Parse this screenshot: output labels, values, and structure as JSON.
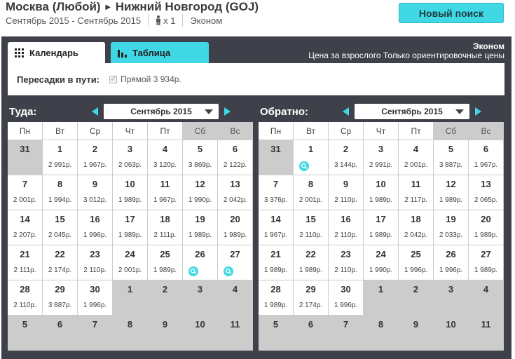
{
  "header": {
    "route_from": "Москва (Любой)",
    "route_to": "Нижний Новгород (GOJ)",
    "dates": "Сентябрь 2015 - Сентябрь 2015",
    "pax": "x 1",
    "cabin": "Эконом",
    "new_search_label": "Новый поиск"
  },
  "tabs": [
    {
      "label": "Календарь",
      "active": true
    },
    {
      "label": "Таблица",
      "active": false
    }
  ],
  "info": {
    "cabin": "Эконом",
    "note": "Цена за взрослого Только ориентировочные цены"
  },
  "filter": {
    "label": "Пересадки в пути:",
    "option": "Прямой 3 934р.",
    "checked": true
  },
  "colors": {
    "accent": "#3fd8e4",
    "panel": "#3e4149",
    "weekend": "#cccccc"
  },
  "weekdays": [
    "Пн",
    "Вт",
    "Ср",
    "Чт",
    "Пт",
    "Сб",
    "Вс"
  ],
  "outbound": {
    "title": "Туда:",
    "month": "Сентябрь 2015",
    "days": [
      {
        "d": "31",
        "p": "",
        "out": true
      },
      {
        "d": "1",
        "p": "2 991р."
      },
      {
        "d": "2",
        "p": "1 967р."
      },
      {
        "d": "3",
        "p": "2 063р."
      },
      {
        "d": "4",
        "p": "3 120р."
      },
      {
        "d": "5",
        "p": "3 869р."
      },
      {
        "d": "6",
        "p": "2 122р."
      },
      {
        "d": "7",
        "p": "2 001р."
      },
      {
        "d": "8",
        "p": "1 994р."
      },
      {
        "d": "9",
        "p": "3 012р."
      },
      {
        "d": "10",
        "p": "1 989р."
      },
      {
        "d": "11",
        "p": "1 967р."
      },
      {
        "d": "12",
        "p": "1 990р."
      },
      {
        "d": "13",
        "p": "2 042р."
      },
      {
        "d": "14",
        "p": "2 207р."
      },
      {
        "d": "15",
        "p": "2 045р."
      },
      {
        "d": "16",
        "p": "1 996р."
      },
      {
        "d": "17",
        "p": "1 989р."
      },
      {
        "d": "18",
        "p": "2 111р."
      },
      {
        "d": "19",
        "p": "1 989р."
      },
      {
        "d": "20",
        "p": "1 989р."
      },
      {
        "d": "21",
        "p": "2 111р."
      },
      {
        "d": "22",
        "p": "2 174р."
      },
      {
        "d": "23",
        "p": "2 110р."
      },
      {
        "d": "24",
        "p": "2 001р."
      },
      {
        "d": "25",
        "p": "1 989р."
      },
      {
        "d": "26",
        "p": "",
        "search": true
      },
      {
        "d": "27",
        "p": "",
        "search": true
      },
      {
        "d": "28",
        "p": "2 110р."
      },
      {
        "d": "29",
        "p": "3 887р."
      },
      {
        "d": "30",
        "p": "1 996р."
      },
      {
        "d": "1",
        "p": "",
        "out": true
      },
      {
        "d": "2",
        "p": "",
        "out": true
      },
      {
        "d": "3",
        "p": "",
        "out": true
      },
      {
        "d": "4",
        "p": "",
        "out": true
      },
      {
        "d": "5",
        "p": "",
        "out": true
      },
      {
        "d": "6",
        "p": "",
        "out": true
      },
      {
        "d": "7",
        "p": "",
        "out": true
      },
      {
        "d": "8",
        "p": "",
        "out": true
      },
      {
        "d": "9",
        "p": "",
        "out": true
      },
      {
        "d": "10",
        "p": "",
        "out": true
      },
      {
        "d": "11",
        "p": "",
        "out": true
      }
    ]
  },
  "inbound": {
    "title": "Обратно:",
    "month": "Сентябрь 2015",
    "days": [
      {
        "d": "31",
        "p": "",
        "out": true
      },
      {
        "d": "1",
        "p": "",
        "search": true
      },
      {
        "d": "2",
        "p": "3 144р."
      },
      {
        "d": "3",
        "p": "2 991р."
      },
      {
        "d": "4",
        "p": "2 001р."
      },
      {
        "d": "5",
        "p": "3 887р."
      },
      {
        "d": "6",
        "p": "1 967р."
      },
      {
        "d": "7",
        "p": "3 376р."
      },
      {
        "d": "8",
        "p": "2 001р."
      },
      {
        "d": "9",
        "p": "2 110р."
      },
      {
        "d": "10",
        "p": "1 989р."
      },
      {
        "d": "11",
        "p": "2 117р."
      },
      {
        "d": "12",
        "p": "1 989р."
      },
      {
        "d": "13",
        "p": "2 065р."
      },
      {
        "d": "14",
        "p": "1 967р."
      },
      {
        "d": "15",
        "p": "2 110р."
      },
      {
        "d": "16",
        "p": "2 110р."
      },
      {
        "d": "17",
        "p": "1 989р."
      },
      {
        "d": "18",
        "p": "2 042р."
      },
      {
        "d": "19",
        "p": "2 033р."
      },
      {
        "d": "20",
        "p": "1 989р."
      },
      {
        "d": "21",
        "p": "1 989р."
      },
      {
        "d": "22",
        "p": "1 989р."
      },
      {
        "d": "23",
        "p": "2 110р."
      },
      {
        "d": "24",
        "p": "1 990р."
      },
      {
        "d": "25",
        "p": "1 996р."
      },
      {
        "d": "26",
        "p": "1 996р."
      },
      {
        "d": "27",
        "p": "1 989р."
      },
      {
        "d": "28",
        "p": "1 989р."
      },
      {
        "d": "29",
        "p": "2 174р."
      },
      {
        "d": "30",
        "p": "1 996р."
      },
      {
        "d": "1",
        "p": "",
        "out": true
      },
      {
        "d": "2",
        "p": "",
        "out": true
      },
      {
        "d": "3",
        "p": "",
        "out": true
      },
      {
        "d": "4",
        "p": "",
        "out": true
      },
      {
        "d": "5",
        "p": "",
        "out": true
      },
      {
        "d": "6",
        "p": "",
        "out": true
      },
      {
        "d": "7",
        "p": "",
        "out": true
      },
      {
        "d": "8",
        "p": "",
        "out": true
      },
      {
        "d": "9",
        "p": "",
        "out": true
      },
      {
        "d": "10",
        "p": "",
        "out": true
      },
      {
        "d": "11",
        "p": "",
        "out": true
      }
    ]
  }
}
